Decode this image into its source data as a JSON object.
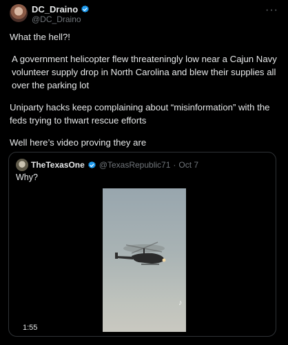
{
  "author": {
    "display_name": "DC_Draino",
    "handle": "@DC_Draino"
  },
  "more_label": "···",
  "tweet_paragraphs": [
    "What the hell?!",
    "A government helicopter flew threateningly low near a Cajun Navy volunteer supply drop in North Carolina and blew their supplies all over the parking lot",
    "Uniparty hacks keep complaining about “misinformation” with the feds trying to thwart rescue efforts",
    "Well here’s video proving they are"
  ],
  "quoted": {
    "display_name": "TheTexasOne",
    "handle": "@TexasRepublic71",
    "separator": "·",
    "date": "Oct 7",
    "text": "Why?",
    "video_duration": "1:55"
  },
  "colors": {
    "background": "#000000",
    "text": "#e7e9ea",
    "muted": "#71767b",
    "verified": "#1d9bf0"
  }
}
